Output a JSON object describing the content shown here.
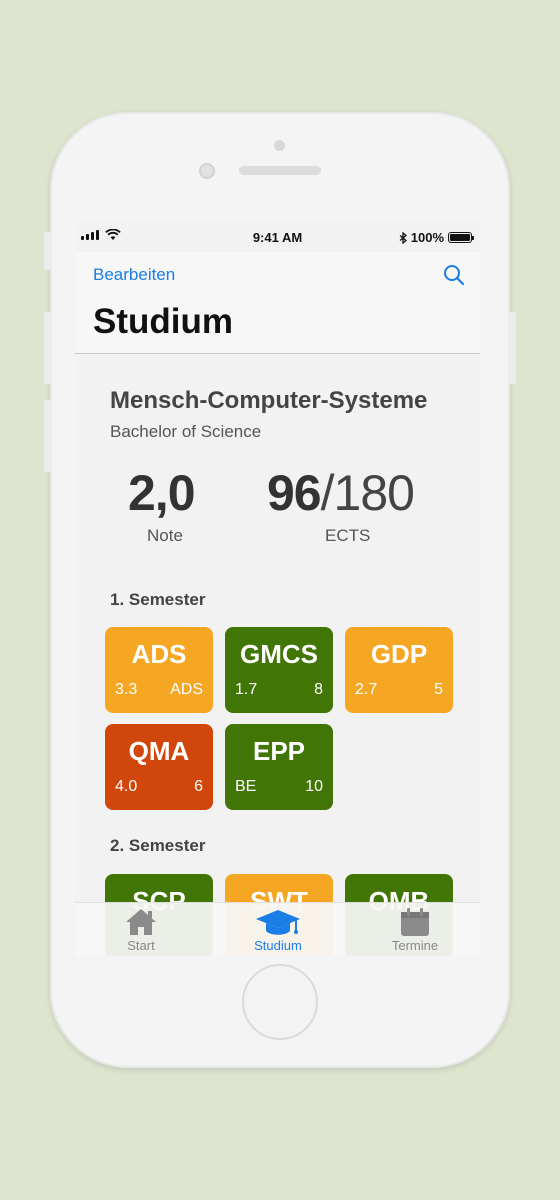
{
  "status_bar": {
    "time": "9:41 AM",
    "battery": "100%",
    "battery_level": 1.0
  },
  "nav": {
    "edit_label": "Bearbeiten",
    "title": "Studium",
    "search_icon": "search-icon"
  },
  "program": {
    "name": "Mensch-Computer-Systeme",
    "degree": "Bachelor of Science",
    "grade": "2,0",
    "grade_label": "Note",
    "ects_done": "96",
    "ects_total": "/180",
    "ects_label": "ECTS"
  },
  "semesters": [
    {
      "heading": "1. Semester",
      "modules": [
        {
          "code": "ADS",
          "grade": "3.3",
          "credit": "ADS",
          "color": "#f5a623"
        },
        {
          "code": "GMCS",
          "grade": "1.7",
          "credit": "8",
          "color": "#417505"
        },
        {
          "code": "GDP",
          "grade": "2.7",
          "credit": "5",
          "color": "#f5a623"
        },
        {
          "code": "QMA",
          "grade": "4.0",
          "credit": "6",
          "color": "#d0460b"
        },
        {
          "code": "EPP",
          "grade": "BE",
          "credit": "10",
          "color": "#417505"
        }
      ]
    },
    {
      "heading": "2. Semester",
      "modules": [
        {
          "code": "SCP",
          "color": "#417505"
        },
        {
          "code": "SWT",
          "color": "#f5a623"
        },
        {
          "code": "OMB",
          "color": "#417505"
        }
      ]
    }
  ],
  "tabbar": {
    "tabs": [
      {
        "label": "Start",
        "icon": "home-icon",
        "active": false
      },
      {
        "label": "Studium",
        "icon": "graduation-cap-icon",
        "active": true
      },
      {
        "label": "Termine",
        "icon": "calendar-icon",
        "active": false
      }
    ]
  },
  "colors": {
    "accent": "#1a7ee6",
    "passed_good": "#417505",
    "passed_ok": "#f5a623",
    "failed": "#d0460b",
    "background": "#dde5cf"
  }
}
